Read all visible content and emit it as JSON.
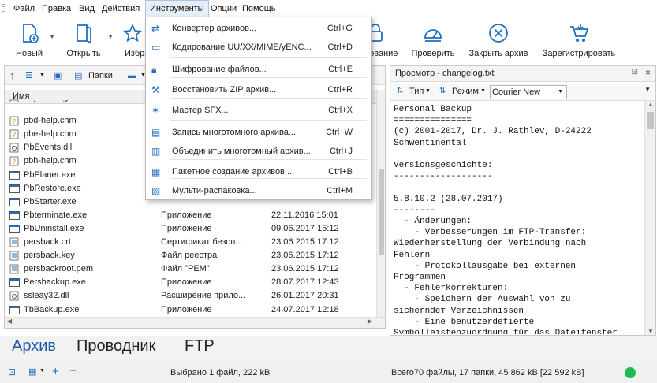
{
  "menubar": {
    "items": [
      "Файл",
      "Правка",
      "Вид",
      "Действия",
      "Инструменты",
      "Опции",
      "Помощь"
    ]
  },
  "toolbar": {
    "buttons": [
      "Новый",
      "Открыть",
      "Избра",
      "рование",
      "Проверить",
      "Закрыть архив",
      "Зарегистрировать"
    ]
  },
  "left_pane": {
    "folders_label": "Папки",
    "column_name": "Имя",
    "files": [
      {
        "name": "notes-en.rtf",
        "type": "",
        "date": ""
      },
      {
        "name": "pbd-help.chm",
        "type": "",
        "date": ""
      },
      {
        "name": "pbe-help.chm",
        "type": "",
        "date": ""
      },
      {
        "name": "PbEvents.dll",
        "type": "",
        "date": ""
      },
      {
        "name": "pbh-help.chm",
        "type": "",
        "date": ""
      },
      {
        "name": "PbPlaner.exe",
        "type": "",
        "date": ""
      },
      {
        "name": "PbRestore.exe",
        "type": "",
        "date": ""
      },
      {
        "name": "PbStarter.exe",
        "type": "",
        "date": ""
      },
      {
        "name": "Pbterminate.exe",
        "type": "Приложение",
        "date": "22.11.2016 15:01"
      },
      {
        "name": "PbUninstall.exe",
        "type": "Приложение",
        "date": "09.06.2017 15:12"
      },
      {
        "name": "persback.crt",
        "type": "Сертификат безоп...",
        "date": "23.06.2015 17:12"
      },
      {
        "name": "persback.key",
        "type": "Файл реестра",
        "date": "23.06.2015 17:12"
      },
      {
        "name": "persbackroot.pem",
        "type": "Файл \"PEM\"",
        "date": "23.06.2015 17:12"
      },
      {
        "name": "Persbackup.exe",
        "type": "Приложение",
        "date": "28.07.2017 12:43"
      },
      {
        "name": "ssleay32.dll",
        "type": "Расширение прило...",
        "date": "26.01.2017 20:31"
      },
      {
        "name": "TbBackup.exe",
        "type": "Приложение",
        "date": "24.07.2017 12:18"
      }
    ]
  },
  "preview": {
    "title": "Просмотр - changelog.txt",
    "type_label": "Тип",
    "mode_label": "Режим",
    "font_value": "Courier New",
    "text": "Personal Backup\n===============\n(c) 2001-2017, Dr. J. Rathlev, D-24222\nSchwentinental\n\nVersionsgeschichte:\n-------------------\n\n5.8.10.2 (28.07.2017)\n--------\n  - Änderungen:\n    - Verbesserungen im FTP-Transfer:\nWiederherstellung der Verbindung nach\nFehlern\n    - Protokollausgabe bei externen\nProgrammen\n  - Fehlerkorrekturen:\n    - Speichern der Auswahl von zu\nsicherndeт Verzeichnissen\n    - Eine benutzerdefierte\nSymbolleistenzuordnung für das Dateifenster"
  },
  "tabs": [
    "Архив",
    "Проводник",
    "FTP"
  ],
  "status": {
    "selected": "Выбрано 1 файл, 222 kB",
    "total": "Всего70 файлы, 17 папки, 45 862 kB [22 592 kB]",
    "indicator_color": "#1db954"
  },
  "tools_menu": [
    {
      "label": "Конвертер архивов...",
      "shortcut": "Ctrl+G",
      "icon": "convert-icon"
    },
    {
      "label": "Кодирование UU/XX/MIME/yENC...",
      "shortcut": "Ctrl+D",
      "icon": "encode-icon"
    },
    {
      "label": "Шифрование файлов...",
      "shortcut": "Ctrl+E",
      "icon": "lock-icon"
    },
    {
      "label": "Восстановить ZIP архив...",
      "shortcut": "Ctrl+R",
      "icon": "wrench-icon"
    },
    {
      "label": "Мастер SFX...",
      "shortcut": "Ctrl+X",
      "icon": "wand-icon"
    },
    {
      "label": "Запись многотомного архива...",
      "shortcut": "Ctrl+W",
      "icon": "volumes-write-icon"
    },
    {
      "label": "Объединить многотомный архив...",
      "shortcut": "Ctrl+J",
      "icon": "volumes-join-icon"
    },
    {
      "label": "Пакетное создание архивов...",
      "shortcut": "Ctrl+B",
      "icon": "batch-icon"
    },
    {
      "label": "Мульти-распаковка...",
      "shortcut": "Ctrl+M",
      "icon": "multi-extract-icon"
    }
  ]
}
